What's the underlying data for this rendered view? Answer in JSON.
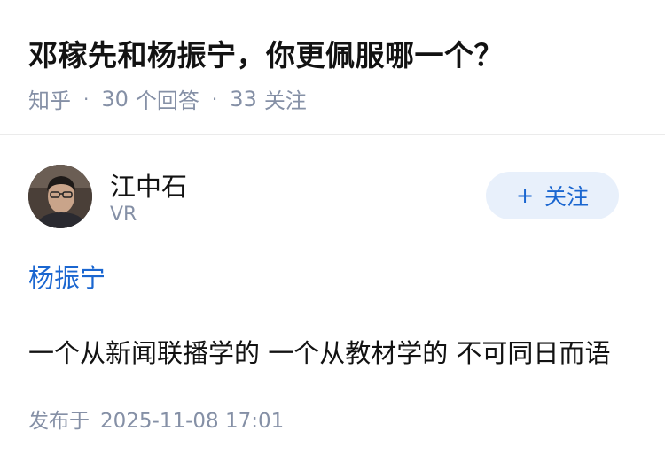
{
  "question": {
    "title": "邓稼先和杨振宁，你更佩服哪一个？",
    "source": "知乎",
    "separator": "·",
    "answer_count": "30",
    "answer_label": "个回答",
    "follow_count": "33",
    "follow_label": "关注"
  },
  "answer": {
    "author": {
      "name": "江中石",
      "bio": "VR",
      "avatar_icon": "avatar-photo",
      "follow_button": {
        "plus": "+",
        "label": "关注"
      }
    },
    "topic_link": "杨振宁",
    "content": "一个从新闻联播学的 一个从教材学的 不可同日而语",
    "publish_label": "发布于",
    "publish_date": "2025-11-08 17:01"
  },
  "colors": {
    "link": "#1a66d0",
    "meta": "#8590a6",
    "follow_bg": "#e8f0fb",
    "text": "#121212"
  }
}
